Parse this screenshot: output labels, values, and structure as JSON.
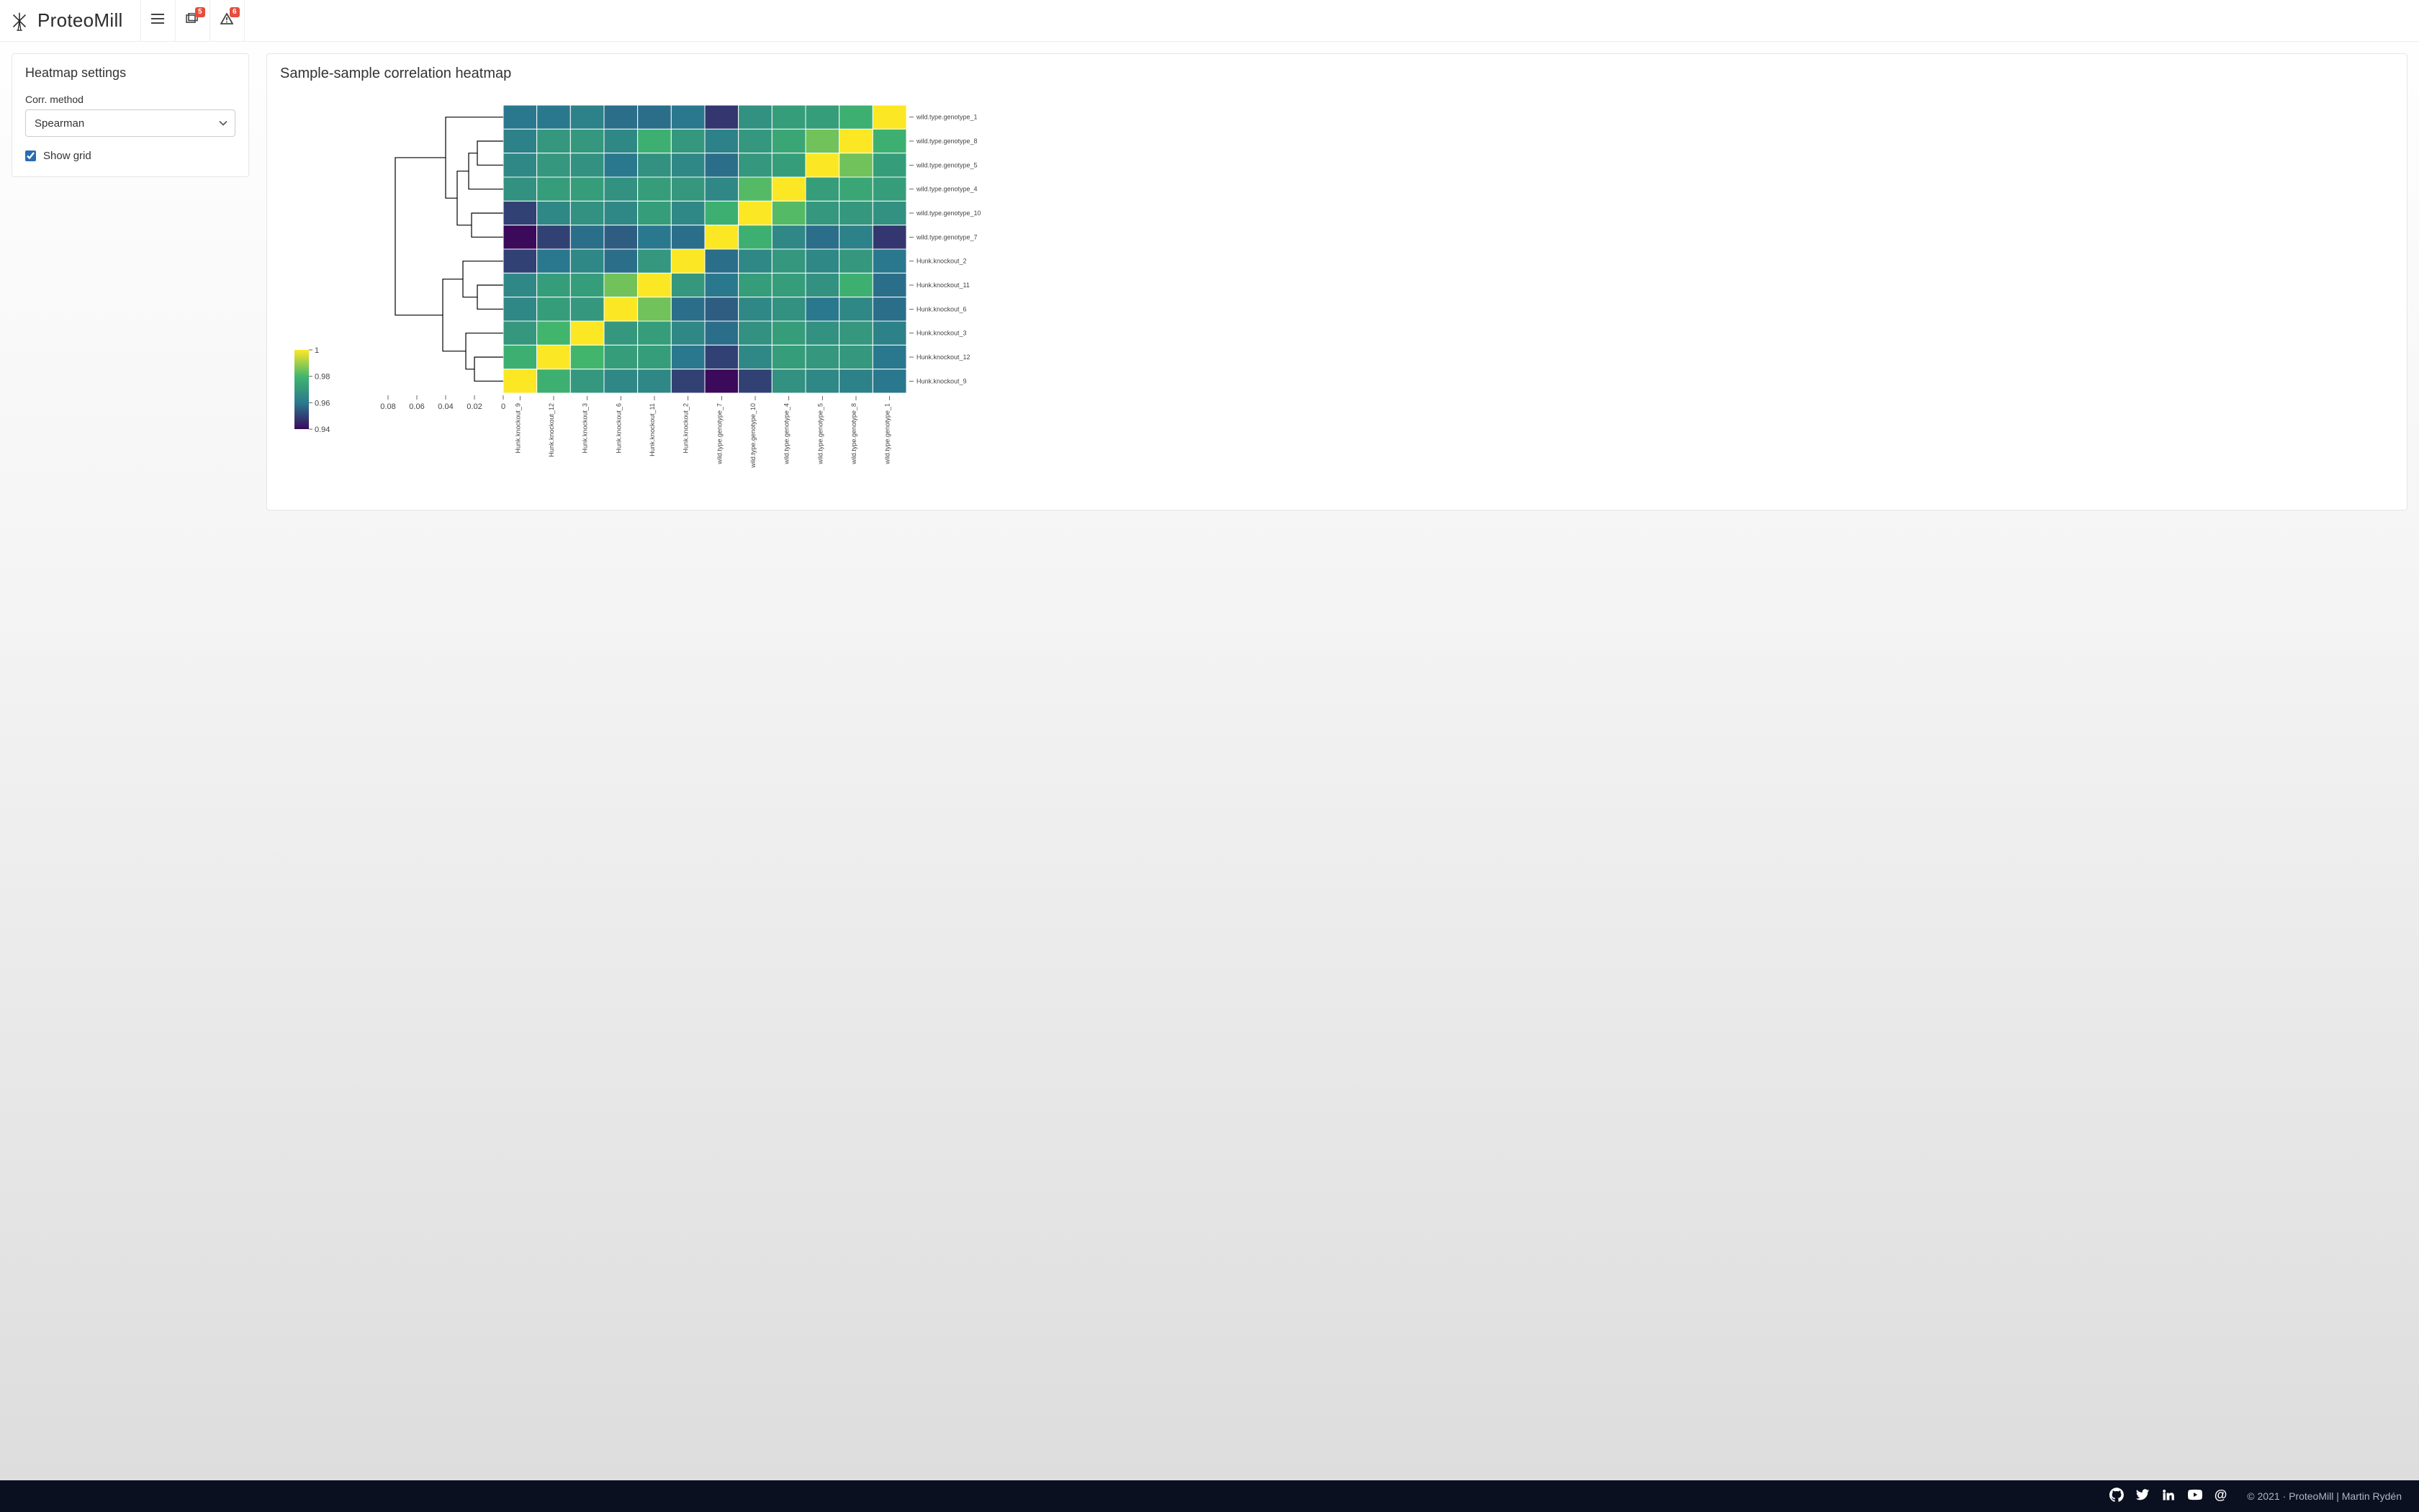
{
  "brand": {
    "name": "ProteoMill"
  },
  "header": {
    "badge_left": "5",
    "badge_right": "6"
  },
  "settings": {
    "title": "Heatmap settings",
    "corr_label": "Corr. method",
    "corr_value": "Spearman",
    "show_grid_label": "Show grid",
    "show_grid_checked": true
  },
  "heatmap": {
    "title": "Sample-sample correlation heatmap"
  },
  "footer": {
    "copyright": "© 2021 · ProteoMill | Martin Rydén"
  },
  "chart_data": {
    "type": "heatmap",
    "title": "Sample-sample correlation heatmap",
    "colorbar": {
      "min": 0.94,
      "max": 1.0,
      "ticks": [
        1,
        0.98,
        0.96,
        0.94
      ]
    },
    "dendrogram_axis": {
      "ticks": [
        0.08,
        0.06,
        0.04,
        0.02,
        0
      ]
    },
    "x_labels": [
      "Hunk.knockout_9",
      "Hunk.knockout_12",
      "Hunk.knockout_3",
      "Hunk.knockout_6",
      "Hunk.knockout_11",
      "Hunk.knockout_2",
      "wild.type.genotype_7",
      "wild.type.genotype_10",
      "wild.type.genotype_4",
      "wild.type.genotype_5",
      "wild.type.genotype_8",
      "wild.type.genotype_1"
    ],
    "y_labels": [
      "wild.type.genotype_1",
      "wild.type.genotype_8",
      "wild.type.genotype_5",
      "wild.type.genotype_4",
      "wild.type.genotype_10",
      "wild.type.genotype_7",
      "Hunk.knockout_2",
      "Hunk.knockout_11",
      "Hunk.knockout_6",
      "Hunk.knockout_3",
      "Hunk.knockout_12",
      "Hunk.knockout_9"
    ],
    "matrix": [
      [
        0.96,
        0.96,
        0.963,
        0.958,
        0.958,
        0.96,
        0.948,
        0.968,
        0.972,
        0.972,
        0.978,
        1.0
      ],
      [
        0.963,
        0.97,
        0.97,
        0.965,
        0.978,
        0.97,
        0.963,
        0.97,
        0.975,
        0.985,
        1.0,
        0.978
      ],
      [
        0.965,
        0.97,
        0.968,
        0.96,
        0.968,
        0.965,
        0.958,
        0.97,
        0.972,
        1.0,
        0.985,
        0.972
      ],
      [
        0.968,
        0.972,
        0.972,
        0.968,
        0.972,
        0.97,
        0.965,
        0.982,
        1.0,
        0.972,
        0.975,
        0.972
      ],
      [
        0.95,
        0.965,
        0.968,
        0.965,
        0.972,
        0.965,
        0.978,
        1.0,
        0.982,
        0.97,
        0.97,
        0.968
      ],
      [
        0.94,
        0.95,
        0.958,
        0.955,
        0.96,
        0.958,
        1.0,
        0.978,
        0.965,
        0.958,
        0.963,
        0.948
      ],
      [
        0.95,
        0.96,
        0.965,
        0.958,
        0.97,
        1.0,
        0.958,
        0.965,
        0.97,
        0.965,
        0.97,
        0.96
      ],
      [
        0.965,
        0.972,
        0.972,
        0.985,
        1.0,
        0.97,
        0.96,
        0.972,
        0.972,
        0.968,
        0.978,
        0.958
      ],
      [
        0.965,
        0.972,
        0.97,
        1.0,
        0.985,
        0.958,
        0.955,
        0.965,
        0.968,
        0.96,
        0.965,
        0.958
      ],
      [
        0.97,
        0.98,
        1.0,
        0.97,
        0.972,
        0.965,
        0.958,
        0.968,
        0.972,
        0.968,
        0.97,
        0.963
      ],
      [
        0.978,
        1.0,
        0.98,
        0.972,
        0.972,
        0.96,
        0.95,
        0.965,
        0.972,
        0.97,
        0.97,
        0.96
      ],
      [
        1.0,
        0.978,
        0.97,
        0.965,
        0.965,
        0.95,
        0.94,
        0.95,
        0.968,
        0.965,
        0.963,
        0.96
      ]
    ]
  }
}
